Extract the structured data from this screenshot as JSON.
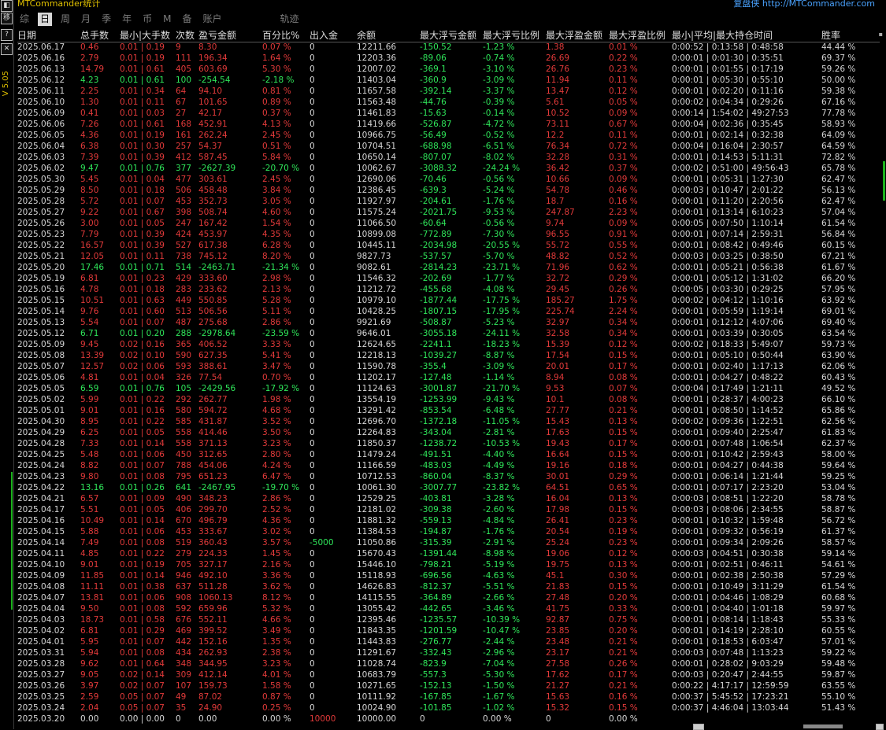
{
  "app": {
    "title": "MTCommander统计",
    "review": "复盘侠 http://MTCommander.com",
    "version": "V 5.05"
  },
  "sidebar": {
    "btn_top": "◧",
    "btn1": "移",
    "btn2": "?",
    "btn3": "✕"
  },
  "tabs": [
    "综",
    "日",
    "周",
    "月",
    "季",
    "年",
    "币",
    "M",
    "备",
    "账户",
    "轨迹"
  ],
  "active_tab": 1,
  "headers": [
    "日期",
    "总手数",
    "最小|大手数",
    "次数",
    "盈亏金额",
    "百分比%",
    "出入金",
    "余额",
    "最大浮亏金额",
    "最大浮亏比例",
    "最大浮盈金额",
    "最大浮盈比例",
    "最小|平均|最大持仓时间",
    "胜率"
  ],
  "rows": [
    [
      "2025.06.17",
      "0.46",
      "0.01 | 0.19",
      "9",
      "8.30",
      "0.07 %",
      "0",
      "12211.66",
      "-150.52",
      "-1.23 %",
      "1.38",
      "0.01 %",
      "0:00:52 | 0:13:58 | 0:48:58",
      "44.44 %"
    ],
    [
      "2025.06.16",
      "2.79",
      "0.01 | 0.19",
      "111",
      "196.34",
      "1.64 %",
      "0",
      "12203.36",
      "-89.06",
      "-0.74 %",
      "26.69",
      "0.22 %",
      "0:00:01 | 0:01:30 | 0:35:51",
      "69.37 %"
    ],
    [
      "2025.06.13",
      "14.79",
      "0.01 | 0.61",
      "405",
      "603.69",
      "5.30 %",
      "0",
      "12007.02",
      "-369.1",
      "-3.10 %",
      "26.76",
      "0.23 %",
      "0:00:01 | 0:01:55 | 0:17:19",
      "59.26 %"
    ],
    [
      "2025.06.12",
      "4.23",
      "0.01 | 0.61",
      "100",
      "-254.54",
      "-2.18 %",
      "0",
      "11403.04",
      "-360.9",
      "-3.09 %",
      "11.94",
      "0.11 %",
      "0:00:01 | 0:05:30 | 0:55:10",
      "50.00 %"
    ],
    [
      "2025.06.11",
      "2.25",
      "0.01 | 0.34",
      "64",
      "94.10",
      "0.81 %",
      "0",
      "11657.58",
      "-392.14",
      "-3.37 %",
      "13.47",
      "0.12 %",
      "0:00:01 | 0:02:20 | 0:11:16",
      "59.38 %"
    ],
    [
      "2025.06.10",
      "1.30",
      "0.01 | 0.11",
      "67",
      "101.65",
      "0.89 %",
      "0",
      "11563.48",
      "-44.76",
      "-0.39 %",
      "5.61",
      "0.05 %",
      "0:00:02 | 0:04:34 | 0:29:26",
      "67.16 %"
    ],
    [
      "2025.06.09",
      "0.41",
      "0.01 | 0.03",
      "27",
      "42.17",
      "0.37 %",
      "0",
      "11461.83",
      "-15.63",
      "-0.14 %",
      "10.52",
      "0.09 %",
      "0:00:14 | 1:54:02 | 49:27:53",
      "77.78 %"
    ],
    [
      "2025.06.06",
      "7.26",
      "0.01 | 0.61",
      "168",
      "452.91",
      "4.13 %",
      "0",
      "11419.66",
      "-526.87",
      "-4.72 %",
      "73.11",
      "0.67 %",
      "0:00:04 | 0:02:36 | 0:35:45",
      "58.93 %"
    ],
    [
      "2025.06.05",
      "4.36",
      "0.01 | 0.19",
      "161",
      "262.24",
      "2.45 %",
      "0",
      "10966.75",
      "-56.49",
      "-0.52 %",
      "12.2",
      "0.11 %",
      "0:00:01 | 0:02:14 | 0:32:38",
      "64.09 %"
    ],
    [
      "2025.06.04",
      "6.38",
      "0.01 | 0.30",
      "257",
      "54.37",
      "0.51 %",
      "0",
      "10704.51",
      "-688.98",
      "-6.51 %",
      "76.34",
      "0.72 %",
      "0:00:04 | 0:16:04 | 2:30:57",
      "64.59 %"
    ],
    [
      "2025.06.03",
      "7.39",
      "0.01 | 0.39",
      "412",
      "587.45",
      "5.84 %",
      "0",
      "10650.14",
      "-807.07",
      "-8.02 %",
      "32.28",
      "0.31 %",
      "0:00:01 | 0:14:53 | 5:11:31",
      "72.82 %"
    ],
    [
      "2025.06.02",
      "9.47",
      "0.01 | 0.76",
      "377",
      "-2627.39",
      "-20.70 %",
      "0",
      "10062.67",
      "-3088.32",
      "-24.24 %",
      "36.42",
      "0.37 %",
      "0:00:02 | 0:51:00 | 49:56:43",
      "65.78 %"
    ],
    [
      "2025.05.30",
      "5.45",
      "0.01 | 0.04",
      "477",
      "303.61",
      "2.45 %",
      "0",
      "12690.06",
      "-70.46",
      "-0.56 %",
      "10.66",
      "0.09 %",
      "0:00:01 | 0:05:31 | 1:27:30",
      "62.47 %"
    ],
    [
      "2025.05.29",
      "8.50",
      "0.01 | 0.18",
      "506",
      "458.48",
      "3.84 %",
      "0",
      "12386.45",
      "-639.3",
      "-5.24 %",
      "54.78",
      "0.46 %",
      "0:00:03 | 0:10:47 | 2:01:22",
      "56.13 %"
    ],
    [
      "2025.05.28",
      "5.72",
      "0.01 | 0.07",
      "453",
      "352.73",
      "3.05 %",
      "0",
      "11927.97",
      "-204.61",
      "-1.76 %",
      "18.7",
      "0.16 %",
      "0:00:01 | 0:11:20 | 2:20:56",
      "62.47 %"
    ],
    [
      "2025.05.27",
      "9.22",
      "0.01 | 0.67",
      "398",
      "508.74",
      "4.60 %",
      "0",
      "11575.24",
      "-2021.75",
      "-9.53 %",
      "247.87",
      "2.23 %",
      "0:00:01 | 0:13:14 | 6:10:23",
      "57.04 %"
    ],
    [
      "2025.05.26",
      "3.00",
      "0.01 | 0.05",
      "247",
      "167.42",
      "1.54 %",
      "0",
      "11066.50",
      "-60.64",
      "-0.56 %",
      "9.74",
      "0.09 %",
      "0:00:05 | 0:07:50 | 1:10:14",
      "61.54 %"
    ],
    [
      "2025.05.23",
      "7.79",
      "0.01 | 0.39",
      "424",
      "453.97",
      "4.35 %",
      "0",
      "10899.08",
      "-772.89",
      "-7.30 %",
      "96.55",
      "0.91 %",
      "0:00:01 | 0:07:14 | 2:59:31",
      "56.84 %"
    ],
    [
      "2025.05.22",
      "16.57",
      "0.01 | 0.39",
      "527",
      "617.38",
      "6.28 %",
      "0",
      "10445.11",
      "-2034.98",
      "-20.55 %",
      "55.72",
      "0.55 %",
      "0:00:01 | 0:08:42 | 0:49:46",
      "60.15 %"
    ],
    [
      "2025.05.21",
      "12.05",
      "0.01 | 0.11",
      "738",
      "745.12",
      "8.20 %",
      "0",
      "9827.73",
      "-537.57",
      "-5.70 %",
      "48.82",
      "0.52 %",
      "0:00:03 | 0:03:25 | 0:38:50",
      "67.21 %"
    ],
    [
      "2025.05.20",
      "17.46",
      "0.01 | 0.71",
      "514",
      "-2463.71",
      "-21.34 %",
      "0",
      "9082.61",
      "-2814.23",
      "-23.71 %",
      "71.96",
      "0.62 %",
      "0:00:01 | 0:05:21 | 0:56:38",
      "61.67 %"
    ],
    [
      "2025.05.19",
      "6.81",
      "0.01 | 0.23",
      "429",
      "333.60",
      "2.98 %",
      "0",
      "11546.32",
      "-202.69",
      "-1.77 %",
      "32.72",
      "0.29 %",
      "0:00:01 | 0:05:12 | 1:31:02",
      "66.20 %"
    ],
    [
      "2025.05.16",
      "4.78",
      "0.01 | 0.18",
      "283",
      "233.62",
      "2.13 %",
      "0",
      "11212.72",
      "-455.68",
      "-4.08 %",
      "29.45",
      "0.26 %",
      "0:00:05 | 0:03:30 | 0:29:25",
      "57.95 %"
    ],
    [
      "2025.05.15",
      "10.51",
      "0.01 | 0.63",
      "449",
      "550.85",
      "5.28 %",
      "0",
      "10979.10",
      "-1877.44",
      "-17.75 %",
      "185.27",
      "1.75 %",
      "0:00:02 | 0:04:12 | 1:10:16",
      "63.92 %"
    ],
    [
      "2025.05.14",
      "9.76",
      "0.01 | 0.60",
      "513",
      "506.56",
      "5.11 %",
      "0",
      "10428.25",
      "-1807.15",
      "-17.95 %",
      "225.74",
      "2.24 %",
      "0:00:01 | 0:05:59 | 1:19:14",
      "69.01 %"
    ],
    [
      "2025.05.13",
      "5.54",
      "0.01 | 0.07",
      "487",
      "275.68",
      "2.86 %",
      "0",
      "9921.69",
      "-508.87",
      "-5.23 %",
      "32.97",
      "0.34 %",
      "0:00:01 | 0:12:12 | 4:07:06",
      "69.40 %"
    ],
    [
      "2025.05.12",
      "6.71",
      "0.01 | 0.20",
      "288",
      "-2978.64",
      "-23.59 %",
      "0",
      "9646.01",
      "-3055.18",
      "-24.11 %",
      "32.58",
      "0.34 %",
      "0:00:01 | 0:03:39 | 0:30:05",
      "63.54 %"
    ],
    [
      "2025.05.09",
      "9.45",
      "0.02 | 0.16",
      "365",
      "406.52",
      "3.33 %",
      "0",
      "12624.65",
      "-2241.1",
      "-18.23 %",
      "15.39",
      "0.12 %",
      "0:00:02 | 0:18:33 | 5:49:07",
      "59.73 %"
    ],
    [
      "2025.05.08",
      "13.39",
      "0.02 | 0.10",
      "590",
      "627.35",
      "5.41 %",
      "0",
      "12218.13",
      "-1039.27",
      "-8.87 %",
      "17.54",
      "0.15 %",
      "0:00:01 | 0:05:10 | 0:50:44",
      "63.90 %"
    ],
    [
      "2025.05.07",
      "12.57",
      "0.02 | 0.06",
      "593",
      "388.61",
      "3.47 %",
      "0",
      "11590.78",
      "-355.4",
      "-3.09 %",
      "20.01",
      "0.17 %",
      "0:00:01 | 0:02:40 | 1:17:13",
      "62.06 %"
    ],
    [
      "2025.05.06",
      "4.81",
      "0.01 | 0.04",
      "326",
      "77.54",
      "0.70 %",
      "0",
      "11202.17",
      "-127.48",
      "-1.14 %",
      "8.94",
      "0.08 %",
      "0:00:01 | 0:04:27 | 0:48:22",
      "60.43 %"
    ],
    [
      "2025.05.05",
      "6.59",
      "0.01 | 0.76",
      "105",
      "-2429.56",
      "-17.92 %",
      "0",
      "11124.63",
      "-3001.87",
      "-21.70 %",
      "9.53",
      "0.07 %",
      "0:00:04 | 0:17:49 | 1:21:11",
      "49.52 %"
    ],
    [
      "2025.05.02",
      "5.99",
      "0.01 | 0.22",
      "292",
      "262.77",
      "1.98 %",
      "0",
      "13554.19",
      "-1253.99",
      "-9.43 %",
      "10.1",
      "0.08 %",
      "0:00:01 | 0:28:37 | 4:00:23",
      "66.10 %"
    ],
    [
      "2025.05.01",
      "9.01",
      "0.01 | 0.16",
      "580",
      "594.72",
      "4.68 %",
      "0",
      "13291.42",
      "-853.54",
      "-6.48 %",
      "27.77",
      "0.21 %",
      "0:00:01 | 0:08:50 | 1:14:52",
      "65.86 %"
    ],
    [
      "2025.04.30",
      "8.95",
      "0.01 | 0.22",
      "585",
      "431.87",
      "3.52 %",
      "0",
      "12696.70",
      "-1372.18",
      "-11.05 %",
      "15.43",
      "0.13 %",
      "0:00:02 | 0:09:36 | 1:22:51",
      "62.56 %"
    ],
    [
      "2025.04.29",
      "6.25",
      "0.01 | 0.05",
      "558",
      "414.46",
      "3.50 %",
      "0",
      "12264.83",
      "-343.04",
      "-2.81 %",
      "17.63",
      "0.15 %",
      "0:00:01 | 0:09:40 | 2:25:47",
      "61.83 %"
    ],
    [
      "2025.04.28",
      "7.33",
      "0.01 | 0.14",
      "558",
      "371.13",
      "3.23 %",
      "0",
      "11850.37",
      "-1238.72",
      "-10.53 %",
      "19.43",
      "0.17 %",
      "0:00:01 | 0:07:48 | 1:06:54",
      "62.37 %"
    ],
    [
      "2025.04.25",
      "5.48",
      "0.01 | 0.06",
      "450",
      "312.65",
      "2.80 %",
      "0",
      "11479.24",
      "-491.51",
      "-4.40 %",
      "16.64",
      "0.15 %",
      "0:00:01 | 0:10:42 | 2:59:43",
      "58.00 %"
    ],
    [
      "2025.04.24",
      "8.82",
      "0.01 | 0.07",
      "788",
      "454.06",
      "4.24 %",
      "0",
      "11166.59",
      "-483.03",
      "-4.49 %",
      "19.16",
      "0.18 %",
      "0:00:01 | 0:04:27 | 0:44:38",
      "59.64 %"
    ],
    [
      "2025.04.23",
      "9.80",
      "0.01 | 0.08",
      "795",
      "651.23",
      "6.47 %",
      "0",
      "10712.53",
      "-860.04",
      "-8.37 %",
      "30.01",
      "0.29 %",
      "0:00:01 | 0:06:14 | 1:21:44",
      "59.25 %"
    ],
    [
      "2025.04.22",
      "13.16",
      "0.01 | 0.26",
      "641",
      "-2467.95",
      "-19.70 %",
      "0",
      "10061.30",
      "-3007.77",
      "-23.82 %",
      "64.51",
      "0.65 %",
      "0:00:01 | 0:07:17 | 2:23:20",
      "53.04 %"
    ],
    [
      "2025.04.21",
      "6.57",
      "0.01 | 0.09",
      "490",
      "348.23",
      "2.86 %",
      "0",
      "12529.25",
      "-403.81",
      "-3.28 %",
      "16.04",
      "0.13 %",
      "0:00:03 | 0:08:51 | 1:22:20",
      "58.78 %"
    ],
    [
      "2025.04.17",
      "5.51",
      "0.01 | 0.05",
      "406",
      "299.70",
      "2.52 %",
      "0",
      "12181.02",
      "-309.38",
      "-2.60 %",
      "17.98",
      "0.15 %",
      "0:00:03 | 0:08:06 | 2:34:55",
      "58.87 %"
    ],
    [
      "2025.04.16",
      "10.49",
      "0.01 | 0.14",
      "670",
      "496.79",
      "4.36 %",
      "0",
      "11881.32",
      "-559.13",
      "-4.84 %",
      "26.41",
      "0.23 %",
      "0:00:01 | 0:10:32 | 1:59:48",
      "56.72 %"
    ],
    [
      "2025.04.15",
      "5.88",
      "0.01 | 0.06",
      "453",
      "333.67",
      "3.02 %",
      "0",
      "11384.53",
      "-194.87",
      "-1.76 %",
      "20.54",
      "0.19 %",
      "0:00:01 | 0:09:32 | 0:56:19",
      "61.37 %"
    ],
    [
      "2025.04.14",
      "7.49",
      "0.01 | 0.08",
      "519",
      "360.43",
      "3.57 %",
      "-5000",
      "11050.86",
      "-315.39",
      "-2.91 %",
      "25.24",
      "0.23 %",
      "0:00:01 | 0:09:34 | 2:09:26",
      "58.57 %"
    ],
    [
      "2025.04.11",
      "4.85",
      "0.01 | 0.22",
      "279",
      "224.33",
      "1.45 %",
      "0",
      "15670.43",
      "-1391.44",
      "-8.98 %",
      "19.06",
      "0.12 %",
      "0:00:03 | 0:04:51 | 0:30:38",
      "59.14 %"
    ],
    [
      "2025.04.10",
      "9.01",
      "0.01 | 0.19",
      "705",
      "327.17",
      "2.16 %",
      "0",
      "15446.10",
      "-798.21",
      "-5.19 %",
      "19.75",
      "0.13 %",
      "0:00:01 | 0:02:51 | 0:46:11",
      "54.61 %"
    ],
    [
      "2025.04.09",
      "11.85",
      "0.01 | 0.14",
      "946",
      "492.10",
      "3.36 %",
      "0",
      "15118.93",
      "-696.56",
      "-4.63 %",
      "45.1",
      "0.30 %",
      "0:00:01 | 0:02:38 | 2:50:38",
      "57.29 %"
    ],
    [
      "2025.04.08",
      "11.11",
      "0.01 | 0.38",
      "637",
      "511.28",
      "3.62 %",
      "0",
      "14626.83",
      "-812.37",
      "-5.51 %",
      "21.83",
      "0.15 %",
      "0:00:01 | 0:10:49 | 3:11:29",
      "61.54 %"
    ],
    [
      "2025.04.07",
      "13.81",
      "0.01 | 0.06",
      "908",
      "1060.13",
      "8.12 %",
      "0",
      "14115.55",
      "-364.89",
      "-2.66 %",
      "27.48",
      "0.20 %",
      "0:00:01 | 0:04:46 | 1:08:29",
      "60.68 %"
    ],
    [
      "2025.04.04",
      "9.50",
      "0.01 | 0.08",
      "592",
      "659.96",
      "5.32 %",
      "0",
      "13055.42",
      "-442.65",
      "-3.46 %",
      "41.75",
      "0.33 %",
      "0:00:01 | 0:04:40 | 1:01:18",
      "59.97 %"
    ],
    [
      "2025.04.03",
      "18.73",
      "0.01 | 0.58",
      "676",
      "552.11",
      "4.66 %",
      "0",
      "12395.46",
      "-1235.57",
      "-10.39 %",
      "92.87",
      "0.75 %",
      "0:00:01 | 0:08:14 | 1:18:43",
      "55.33 %"
    ],
    [
      "2025.04.02",
      "6.81",
      "0.01 | 0.29",
      "469",
      "399.52",
      "3.49 %",
      "0",
      "11843.35",
      "-1201.59",
      "-10.47 %",
      "23.85",
      "0.20 %",
      "0:00:01 | 0:14:19 | 2:28:10",
      "60.55 %"
    ],
    [
      "2025.04.01",
      "5.95",
      "0.01 | 0.07",
      "442",
      "152.16",
      "1.35 %",
      "0",
      "11443.83",
      "-276.77",
      "-2.44 %",
      "23.48",
      "0.21 %",
      "0:00:01 | 0:18:53 | 6:03:47",
      "57.01 %"
    ],
    [
      "2025.03.31",
      "5.94",
      "0.01 | 0.08",
      "434",
      "262.93",
      "2.38 %",
      "0",
      "11291.67",
      "-332.43",
      "-2.96 %",
      "23.17",
      "0.21 %",
      "0:00:03 | 0:07:48 | 1:13:23",
      "59.22 %"
    ],
    [
      "2025.03.28",
      "9.62",
      "0.01 | 0.64",
      "348",
      "344.95",
      "3.23 %",
      "0",
      "11028.74",
      "-823.9",
      "-7.04 %",
      "27.58",
      "0.26 %",
      "0:00:01 | 0:28:02 | 9:03:29",
      "59.48 %"
    ],
    [
      "2025.03.27",
      "9.05",
      "0.02 | 0.14",
      "309",
      "412.14",
      "4.01 %",
      "0",
      "10683.79",
      "-557.3",
      "-5.30 %",
      "17.62",
      "0.17 %",
      "0:00:03 | 0:20:47 | 2:44:55",
      "59.87 %"
    ],
    [
      "2025.03.26",
      "3.97",
      "0.02 | 0.07",
      "107",
      "159.73",
      "1.58 %",
      "0",
      "10271.65",
      "-152.13",
      "-1.50 %",
      "21.27",
      "0.21 %",
      "0:00:22 | 4:17:17 | 12:59:59",
      "63.55 %"
    ],
    [
      "2025.03.25",
      "2.59",
      "0.05 | 0.07",
      "49",
      "87.02",
      "0.87 %",
      "0",
      "10111.92",
      "-167.85",
      "-1.67 %",
      "15.63",
      "0.16 %",
      "0:00:37 | 5:45:52 | 17:23:21",
      "55.10 %"
    ],
    [
      "2025.03.24",
      "2.04",
      "0.05 | 0.07",
      "35",
      "24.90",
      "0.25 %",
      "0",
      "10024.90",
      "-101.85",
      "-1.02 %",
      "15.32",
      "0.15 %",
      "0:00:37 | 4:46:04 | 13:03:44",
      "51.43 %"
    ],
    [
      "2025.03.20",
      "0.00",
      "0.00 | 0.00",
      "0",
      "0.00",
      "0.00 %",
      "10000",
      "10000.00",
      "0",
      "0.00 %",
      "0",
      "0.00 %",
      "",
      ""
    ]
  ],
  "colors": {
    "profit": "#e23a3a",
    "loss": "#2fe65a",
    "neutral": "#d6d6d6",
    "title": "#e0c000",
    "link": "#4aa3ff"
  }
}
